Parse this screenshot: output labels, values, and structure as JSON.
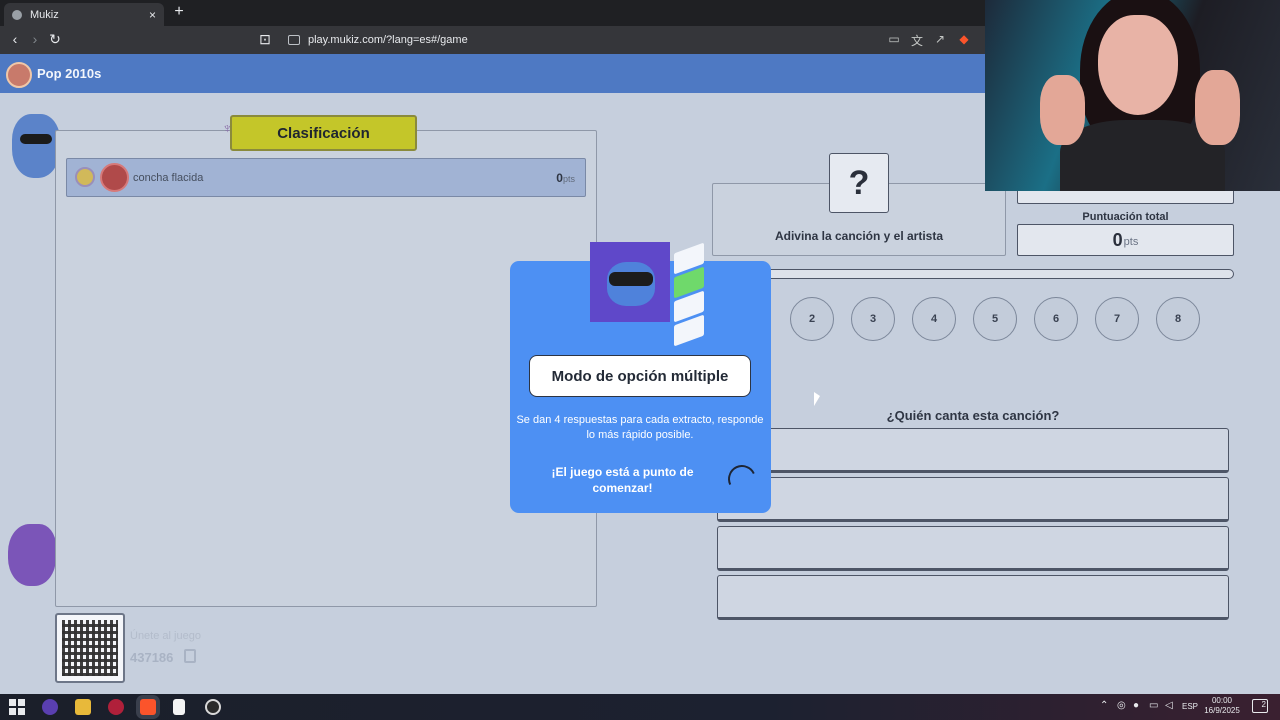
{
  "browser": {
    "tab_title": "Mukiz",
    "tab_close": "×",
    "new_tab": "+",
    "url": "play.mukiz.com/?lang=es#/game"
  },
  "game": {
    "category": "Pop 2010s",
    "leaderboard_title": "Clasificación",
    "players": [
      {
        "name": "concha flacida",
        "score": "0",
        "unit": "pts"
      }
    ],
    "join_label": "Únete al juego",
    "join_code": "437186",
    "song_prompt": "Adivina la canción y el artista",
    "question_mark": "?",
    "total_label": "Puntuación total",
    "total_score": "0",
    "total_unit": "pts",
    "rounds": [
      "2",
      "3",
      "4",
      "5",
      "6",
      "7",
      "8"
    ],
    "question": "¿Quién canta esta canción?"
  },
  "modal": {
    "title": "Modo de opción múltiple",
    "description": "Se dan 4 respuestas para cada extracto, responde lo más rápido posible.",
    "starting": "¡El juego está a punto de comenzar!"
  },
  "taskbar": {
    "lang": "ESP",
    "time": "00:00",
    "date": "16/9/2025",
    "notifications": "2"
  },
  "colors": {
    "topbar": "#4e79c3",
    "modal": "#4d90f3",
    "leaderboard_header": "#c4c629",
    "page_bg": "#c6cfdd"
  }
}
